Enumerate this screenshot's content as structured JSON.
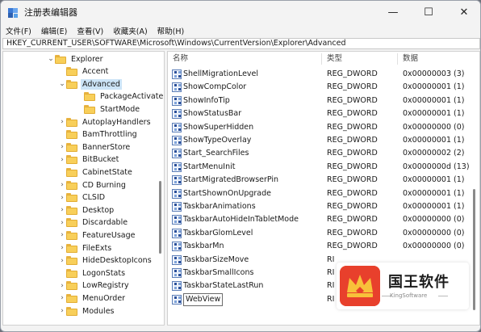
{
  "window": {
    "title": "注册表编辑器",
    "controls": {
      "minimize": "—",
      "maximize": "☐",
      "close": "✕"
    }
  },
  "menu": [
    "文件(F)",
    "编辑(E)",
    "查看(V)",
    "收藏夹(A)",
    "帮助(H)"
  ],
  "address": "HKEY_CURRENT_USER\\SOFTWARE\\Microsoft\\Windows\\CurrentVersion\\Explorer\\Advanced",
  "tree": {
    "items": [
      {
        "label": "Explorer",
        "chevron": "v",
        "level": 0
      },
      {
        "label": "Accent",
        "chevron": "",
        "level": 1
      },
      {
        "label": "Advanced",
        "chevron": "v",
        "level": 1,
        "selected": true
      },
      {
        "label": "PackageActivate",
        "chevron": "",
        "level": 2
      },
      {
        "label": "StartMode",
        "chevron": "",
        "level": 2
      },
      {
        "label": "AutoplayHandlers",
        "chevron": ">",
        "level": 1
      },
      {
        "label": "BamThrottling",
        "chevron": "",
        "level": 1
      },
      {
        "label": "BannerStore",
        "chevron": ">",
        "level": 1
      },
      {
        "label": "BitBucket",
        "chevron": ">",
        "level": 1
      },
      {
        "label": "CabinetState",
        "chevron": "",
        "level": 1
      },
      {
        "label": "CD Burning",
        "chevron": ">",
        "level": 1
      },
      {
        "label": "CLSID",
        "chevron": ">",
        "level": 1
      },
      {
        "label": "Desktop",
        "chevron": ">",
        "level": 1
      },
      {
        "label": "Discardable",
        "chevron": ">",
        "level": 1
      },
      {
        "label": "FeatureUsage",
        "chevron": ">",
        "level": 1
      },
      {
        "label": "FileExts",
        "chevron": ">",
        "level": 1
      },
      {
        "label": "HideDesktopIcons",
        "chevron": ">",
        "level": 1
      },
      {
        "label": "LogonStats",
        "chevron": "",
        "level": 1
      },
      {
        "label": "LowRegistry",
        "chevron": ">",
        "level": 1
      },
      {
        "label": "MenuOrder",
        "chevron": ">",
        "level": 1
      },
      {
        "label": "Modules",
        "chevron": ">",
        "level": 1
      }
    ]
  },
  "values": {
    "headers": {
      "name": "名称",
      "type": "类型",
      "data": "数据"
    },
    "rows": [
      {
        "name": "ShellMigrationLevel",
        "type": "REG_DWORD",
        "data": "0x00000003 (3)"
      },
      {
        "name": "ShowCompColor",
        "type": "REG_DWORD",
        "data": "0x00000001 (1)"
      },
      {
        "name": "ShowInfoTip",
        "type": "REG_DWORD",
        "data": "0x00000001 (1)"
      },
      {
        "name": "ShowStatusBar",
        "type": "REG_DWORD",
        "data": "0x00000001 (1)"
      },
      {
        "name": "ShowSuperHidden",
        "type": "REG_DWORD",
        "data": "0x00000000 (0)"
      },
      {
        "name": "ShowTypeOverlay",
        "type": "REG_DWORD",
        "data": "0x00000001 (1)"
      },
      {
        "name": "Start_SearchFiles",
        "type": "REG_DWORD",
        "data": "0x00000002 (2)"
      },
      {
        "name": "StartMenuInit",
        "type": "REG_DWORD",
        "data": "0x0000000d (13)"
      },
      {
        "name": "StartMigratedBrowserPin",
        "type": "REG_DWORD",
        "data": "0x00000001 (1)"
      },
      {
        "name": "StartShownOnUpgrade",
        "type": "REG_DWORD",
        "data": "0x00000001 (1)"
      },
      {
        "name": "TaskbarAnimations",
        "type": "REG_DWORD",
        "data": "0x00000001 (1)"
      },
      {
        "name": "TaskbarAutoHideInTabletMode",
        "type": "REG_DWORD",
        "data": "0x00000000 (0)"
      },
      {
        "name": "TaskbarGlomLevel",
        "type": "REG_DWORD",
        "data": "0x00000000 (0)"
      },
      {
        "name": "TaskbarMn",
        "type": "REG_DWORD",
        "data": "0x00000000 (0)"
      },
      {
        "name": "TaskbarSizeMove",
        "type": "RI",
        "data": ""
      },
      {
        "name": "TaskbarSmallIcons",
        "type": "RI",
        "data": ""
      },
      {
        "name": "TaskbarStateLastRun",
        "type": "RI",
        "data": ""
      },
      {
        "name": "WebView",
        "type": "RI",
        "data": "",
        "editing": true
      }
    ]
  },
  "watermark": {
    "title": "国王软件",
    "subtitle": "KingSoftware",
    "badge_color": "#e8402c"
  },
  "icons": {
    "value_icon": "reg-dword-icon",
    "folder_icon": "folder-icon",
    "app_icon": "regedit-icon"
  },
  "colors": {
    "selection": "#cce4f7",
    "folder": "#f8cf5a"
  }
}
